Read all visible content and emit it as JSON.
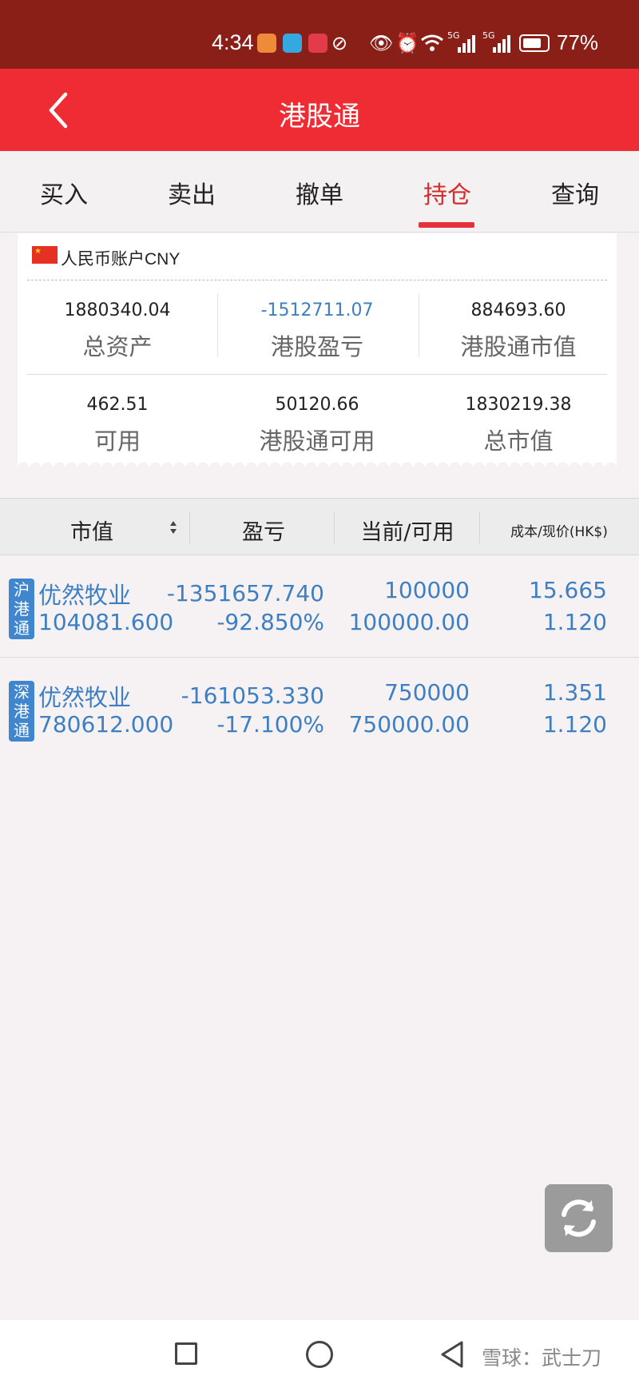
{
  "status_bar": {
    "time": "4:34",
    "battery": "77%",
    "battery_level": 0.77,
    "network_a": "5G",
    "network_b": "5G",
    "notification_icons": [
      "taobao-icon",
      "reader-icon",
      "xiaohongshu-icon",
      "link-icon"
    ]
  },
  "nav": {
    "title": "港股通"
  },
  "tabs": [
    {
      "label": "买入"
    },
    {
      "label": "卖出"
    },
    {
      "label": "撤单"
    },
    {
      "label": "持仓",
      "active": true
    },
    {
      "label": "查询"
    }
  ],
  "account": {
    "name": "人民币账户CNY",
    "cells": [
      {
        "value": "1880340.04",
        "label": "总资产"
      },
      {
        "value": "-1512711.07",
        "label": "港股盈亏"
      },
      {
        "value": "884693.60",
        "label": "港股通市值"
      },
      {
        "value": "462.51",
        "label": "可用"
      },
      {
        "value": "50120.66",
        "label": "港股通可用"
      },
      {
        "value": "1830219.38",
        "label": "总市值"
      }
    ]
  },
  "table_header": {
    "market_value": "市值",
    "pnl": "盈亏",
    "current_available": "当前/可用",
    "cost_price": "成本/现价(HK$)"
  },
  "holdings": [
    {
      "market_tag": "沪港通",
      "name": "优然牧业",
      "market_value": "104081.600",
      "pnl": "-1351657.740",
      "pnl_pct": "-92.850%",
      "current": "100000",
      "available": "100000.00",
      "cost": "15.665",
      "price": "1.120"
    },
    {
      "market_tag": "深港通",
      "name": "优然牧业",
      "market_value": "780612.000",
      "pnl": "-161053.330",
      "pnl_pct": "-17.100%",
      "current": "750000",
      "available": "750000.00",
      "cost": "1.351",
      "price": "1.120"
    }
  ],
  "watermark": "雪球：武士刀",
  "colors": {
    "status_bar": "#8a1f17",
    "nav_bar": "#ef2b34",
    "accent_red": "#e6313a",
    "value_blue": "#3e7fc4",
    "tag_blue": "#3f86cf"
  }
}
